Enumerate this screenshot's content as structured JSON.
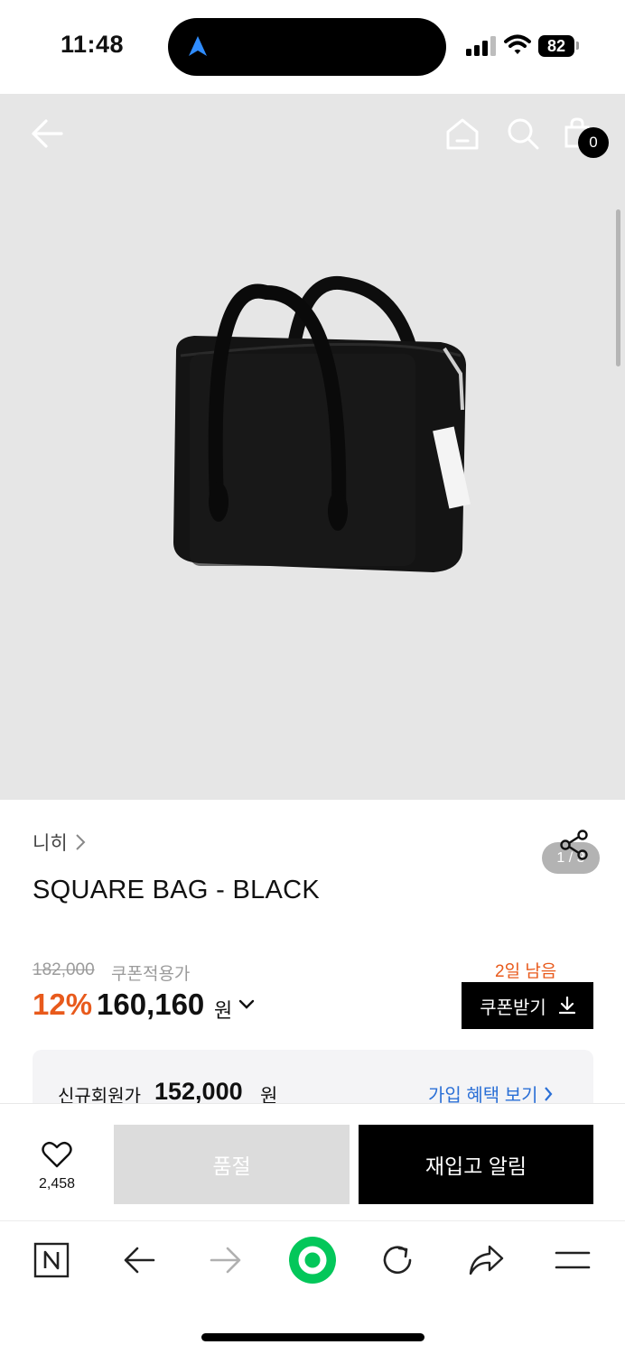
{
  "status_bar": {
    "time": "11:48",
    "battery": "82",
    "icons": [
      "navigation-arrow-icon",
      "cellular-signal-icon",
      "wifi-icon",
      "battery-icon"
    ]
  },
  "header": {
    "icons": [
      "back-arrow-icon",
      "home-icon",
      "search-icon",
      "shopping-bag-icon"
    ],
    "cart_count": "0"
  },
  "gallery": {
    "pager": "1 / 3"
  },
  "product": {
    "brand": "니히",
    "title": "SQUARE BAG - BLACK",
    "original_price": "182,000",
    "coupon_label": "쿠폰적용가",
    "discount": "12%",
    "price": "160,160",
    "price_unit": "원",
    "days_left": "2일 남음",
    "coupon_button": "쿠폰받기",
    "member_label": "신규회원가",
    "member_price": "152,000",
    "member_unit": "원",
    "benefit_link": "가입 혜택 보기"
  },
  "purchase_bar": {
    "like_count": "2,458",
    "soldout_label": "품절",
    "restock_label": "재입고 알림"
  },
  "browser_toolbar": {
    "icons": [
      "naver-n-icon",
      "back-icon",
      "forward-icon",
      "green-circle-icon",
      "reload-icon",
      "share-icon",
      "menu-icon"
    ]
  },
  "colors": {
    "accent_orange": "#e85a1c",
    "link_blue": "#2a6fd6",
    "naver_green": "#03c75a"
  }
}
